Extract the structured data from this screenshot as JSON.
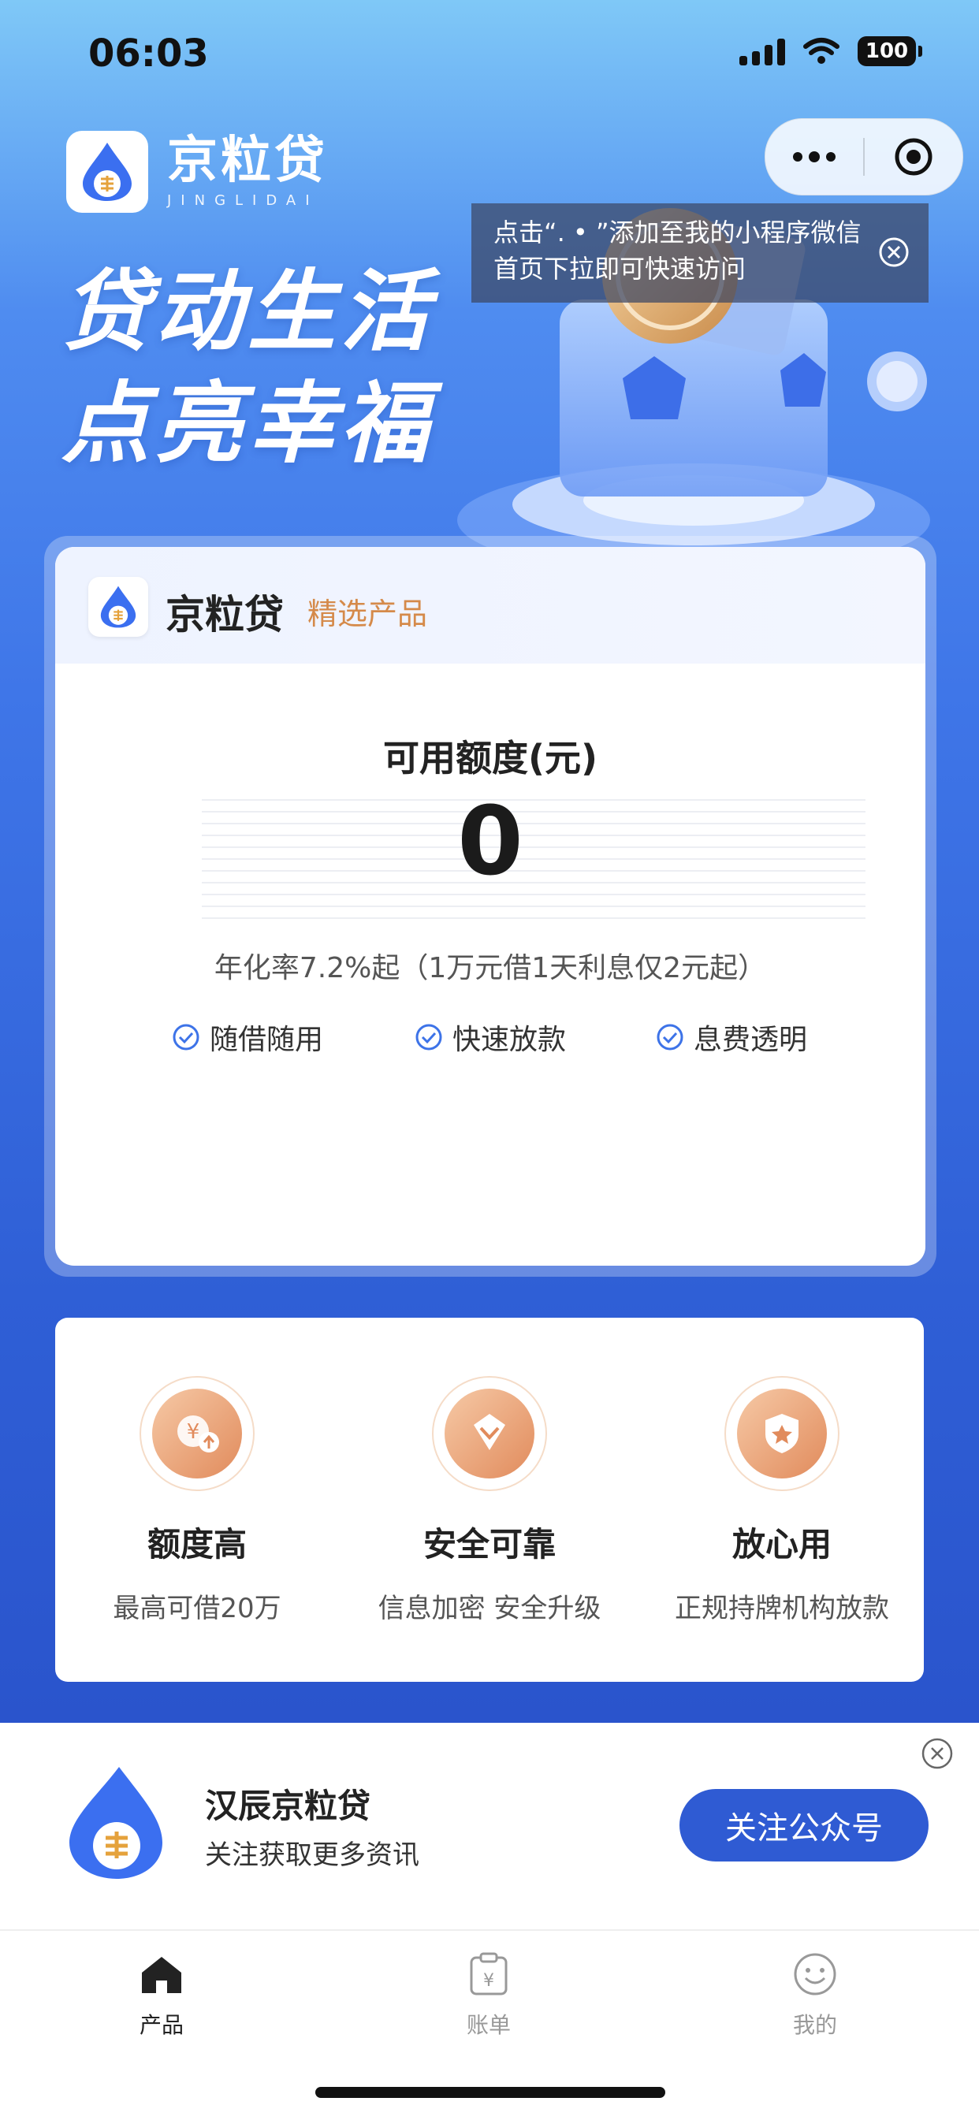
{
  "status_bar": {
    "time": "06:03",
    "battery": "100"
  },
  "brand": {
    "name_cn": "京粒贷",
    "name_en": "JINGLIDAI"
  },
  "mini_program_capsule": {
    "more_icon": "more-dots-icon",
    "close_icon": "target-close-icon"
  },
  "tooltip": {
    "text": "点击“. • ”添加至我的小程序微信首页下拉即可快速访问"
  },
  "slogan": {
    "line1": "贷动生活",
    "line2": "点亮幸福"
  },
  "product_card": {
    "name": "京粒贷",
    "tag": "精选产品",
    "quota_label": "可用额度(元)",
    "quota_value": "0",
    "rate_text": "年化率7.2%起（1万元借1天利息仅2元起）",
    "features": [
      "随借随用",
      "快速放款",
      "息费透明"
    ]
  },
  "advantages": [
    {
      "icon": "yuan-up-icon",
      "title": "额度高",
      "desc": "最高可借20万"
    },
    {
      "icon": "diamond-icon",
      "title": "安全可靠",
      "desc": "信息加密 安全升级"
    },
    {
      "icon": "star-shield-icon",
      "title": "放心用",
      "desc": "正规持牌机构放款"
    }
  ],
  "follow_banner": {
    "name": "汉辰京粒贷",
    "subtitle": "关注获取更多资讯",
    "button": "关注公众号"
  },
  "tabbar": {
    "active_color": "#222222",
    "inactive_color": "#999999",
    "tabs": [
      {
        "label": "产品",
        "icon": "home-icon"
      },
      {
        "label": "账单",
        "icon": "bill-icon"
      },
      {
        "label": "我的",
        "icon": "smile-icon"
      }
    ]
  }
}
